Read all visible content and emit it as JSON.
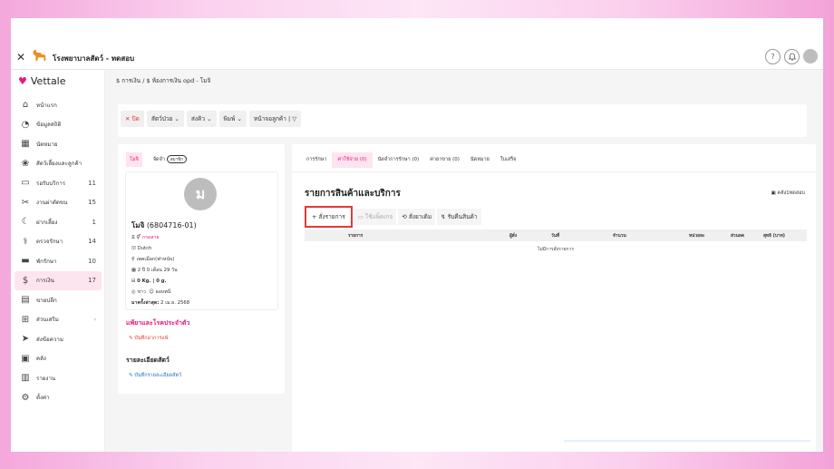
{
  "app": {
    "title": "โรงพยาบาลสัตว์ - ทดสอบ",
    "brand": "Vettale"
  },
  "topbar": {
    "close_glyph": "✕",
    "help_glyph": "?",
    "bell_glyph": "🔔"
  },
  "sidebar": {
    "items": [
      {
        "label": "หน้าแรก",
        "icon": "home-icon",
        "glyph": "⌂",
        "count": ""
      },
      {
        "label": "ข้อมูลสถิติ",
        "icon": "stats-icon",
        "glyph": "◔",
        "count": ""
      },
      {
        "label": "นัดหมาย",
        "icon": "calendar-icon",
        "glyph": "▦",
        "count": ""
      },
      {
        "label": "สัตว์เลี้ยงและลูกค้า",
        "icon": "paw-icon",
        "glyph": "❀",
        "count": ""
      },
      {
        "label": "รอรับบริการ",
        "icon": "sofa-icon",
        "glyph": "▭",
        "count": "11"
      },
      {
        "label": "งานผ่าตัดขน",
        "icon": "scissors-icon",
        "glyph": "✂",
        "count": "15"
      },
      {
        "label": "ฝากเลี้ยง",
        "icon": "moon-icon",
        "glyph": "☾",
        "count": "1"
      },
      {
        "label": "ตรวจรักษา",
        "icon": "stethoscope-icon",
        "glyph": "⚕",
        "count": "14"
      },
      {
        "label": "พักรักษา",
        "icon": "bed-icon",
        "glyph": "▬",
        "count": "10"
      },
      {
        "label": "การเงิน",
        "icon": "money-icon",
        "glyph": "$",
        "count": "17"
      },
      {
        "label": "ขายปลีก",
        "icon": "register-icon",
        "glyph": "▤",
        "count": ""
      },
      {
        "label": "ส่วนเสริม",
        "icon": "plus-box-icon",
        "glyph": "⊞",
        "count": "",
        "chev": "›"
      },
      {
        "label": "ส่งข้อความ",
        "icon": "send-icon",
        "glyph": "➤",
        "count": ""
      },
      {
        "label": "คลัง",
        "icon": "box-icon",
        "glyph": "▣",
        "count": ""
      },
      {
        "label": "รายงาน",
        "icon": "chart-icon",
        "glyph": "▥",
        "count": ""
      },
      {
        "label": "ตั้งค่า",
        "icon": "gear-icon",
        "glyph": "⚙",
        "count": ""
      }
    ],
    "active_index": 9
  },
  "breadcrumb": {
    "part1": "การเงิน",
    "sep": "/",
    "part2": "ห้องการเงิน opd",
    "dash": "-",
    "part3": "โมจิ"
  },
  "toolbar": {
    "close": "ปิด",
    "pet": "สัตว์ป่วย",
    "send": "ส่งคิว",
    "print": "พิมพ์",
    "customer_page": "หน้าจอลูกค้า |"
  },
  "petcard": {
    "tab1": "โมจิ",
    "tab2": "จัดจำ",
    "badge": "สมาชิก",
    "avatar_letter": "ม",
    "name": "โมจิ",
    "hn": "(6804716-01)",
    "line_sex": "กรอสาย",
    "breed": "Dutch",
    "species": "เพคเมือก(ฟาหนับ)",
    "age": "2 ปี 0 เดือน 29 วัน",
    "weight": "0 Kg. | 0 g.",
    "color": "ขาว",
    "color_label": "ธอบทนี",
    "last_visit_label": "มาครั้งล่าสุด:",
    "last_visit": "2 เม.ย. 2568",
    "allergy_title": "แพ้ยาและโรคประจำตัว",
    "allergy_link": "บันทึกอาการแพ้",
    "details_title": "รายละเอียดสัตว์",
    "details_link": "บันทึกรายละเอียดสัตว์"
  },
  "tabs": [
    "การรักษา",
    "ค่าใช้จ่าย (0)",
    "นัดจำการรักษา (0)",
    "ค่ายาขาย (0)",
    "นัดหมาย",
    "ใบเสร็จ"
  ],
  "active_tab": 1,
  "section": {
    "title": "รายการสินค้าและบริการ",
    "stock": "คลัง1ทดสอบ"
  },
  "actions": {
    "add": "สั่งรายการ",
    "package": "ใช้แพ็คเกจ",
    "reorder": "สั่งยาเดิม",
    "return": "รับคืนสินค้า"
  },
  "table": {
    "headers": [
      "รายการ",
      "ผู้สั่ง",
      "วันที่",
      "จำนวน",
      "หน่วยละ",
      "ส่วนลด",
      "สุทธิ (บาท)"
    ],
    "empty": "ไม่มีการสั่งรายการ"
  }
}
